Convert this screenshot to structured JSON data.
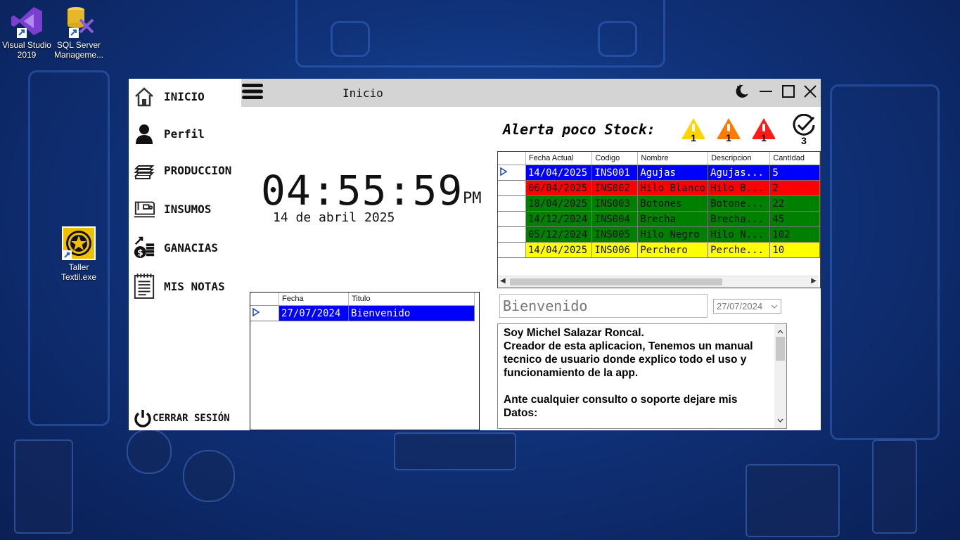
{
  "desktop": {
    "icons": [
      {
        "label": "Visual Studio 2019"
      },
      {
        "label": "SQL Server Manageme..."
      },
      {
        "label": "Taller Textil.exe"
      }
    ]
  },
  "window": {
    "title": "Inicio",
    "buttons": {
      "moon": "moon-icon",
      "minimize": "minimize-icon",
      "maximize": "maximize-icon",
      "close": "close-icon"
    }
  },
  "sidebar": {
    "items": [
      {
        "label": "INICIO",
        "icon": "home-icon"
      },
      {
        "label": "Perfil",
        "icon": "user-icon"
      },
      {
        "label": "PRODUCCION",
        "icon": "fabric-stack-icon"
      },
      {
        "label": "INSUMOS",
        "icon": "sewing-machine-icon"
      },
      {
        "label": "GANACIAS",
        "icon": "money-icon"
      },
      {
        "label": "MIS NOTAS",
        "icon": "notepad-icon"
      }
    ],
    "logout": "CERRAR SESIÓN"
  },
  "clock": {
    "time": "04:55:59",
    "ampm": "PM",
    "date": "14 de abril 2025"
  },
  "stock_alert": {
    "title": "Alerta poco Stock:",
    "counts": {
      "yellow": "1",
      "orange": "1",
      "red": "1",
      "ok": "3"
    },
    "colors": {
      "yellow": "#ffd700",
      "orange": "#ff8000",
      "red": "#ff1a1a"
    },
    "columns": [
      "Fecha Actual",
      "Codigo",
      "Nombre",
      "Descripcion",
      "CantIdad"
    ],
    "rows": [
      {
        "fecha": "14/04/2025",
        "codigo": "INS001",
        "nombre": "Agujas",
        "desc": "Agujas...",
        "cant": "5",
        "bg": "#0000ff",
        "fg": "#ffffff"
      },
      {
        "fecha": "06/04/2025",
        "codigo": "INS002",
        "nombre": "Hilo Blanco",
        "desc": "Hilo B...",
        "cant": "2",
        "bg": "#ff0000",
        "fg": "#111111"
      },
      {
        "fecha": "18/04/2025",
        "codigo": "INS003",
        "nombre": "Botones",
        "desc": "Botone...",
        "cant": "22",
        "bg": "#008000",
        "fg": "#111111"
      },
      {
        "fecha": "14/12/2024",
        "codigo": "INS004",
        "nombre": "Brecha",
        "desc": "Brecha...",
        "cant": "45",
        "bg": "#008000",
        "fg": "#111111"
      },
      {
        "fecha": "05/12/2024",
        "codigo": "INS005",
        "nombre": "Hilo Negro",
        "desc": "Hilo N...",
        "cant": "102",
        "bg": "#008000",
        "fg": "#111111"
      },
      {
        "fecha": "14/04/2025",
        "codigo": "INS006",
        "nombre": "Perchero",
        "desc": "Perche...",
        "cant": "10",
        "bg": "#ffff00",
        "fg": "#111111"
      }
    ]
  },
  "notes_grid": {
    "columns": [
      "Fecha",
      "Titulo"
    ],
    "rows": [
      {
        "fecha": "27/07/2024",
        "titulo": "Bienvenido"
      }
    ]
  },
  "note": {
    "title": "Bienvenido",
    "date": "27/07/2024",
    "body": "Soy Michel Salazar Roncal.\nCreador de esta aplicacion, Tenemos un manual tecnico de usuario donde explico todo el uso y funcionamiento de la app.\n\nAnte cualquier consulto o soporte dejare mis Datos:"
  }
}
